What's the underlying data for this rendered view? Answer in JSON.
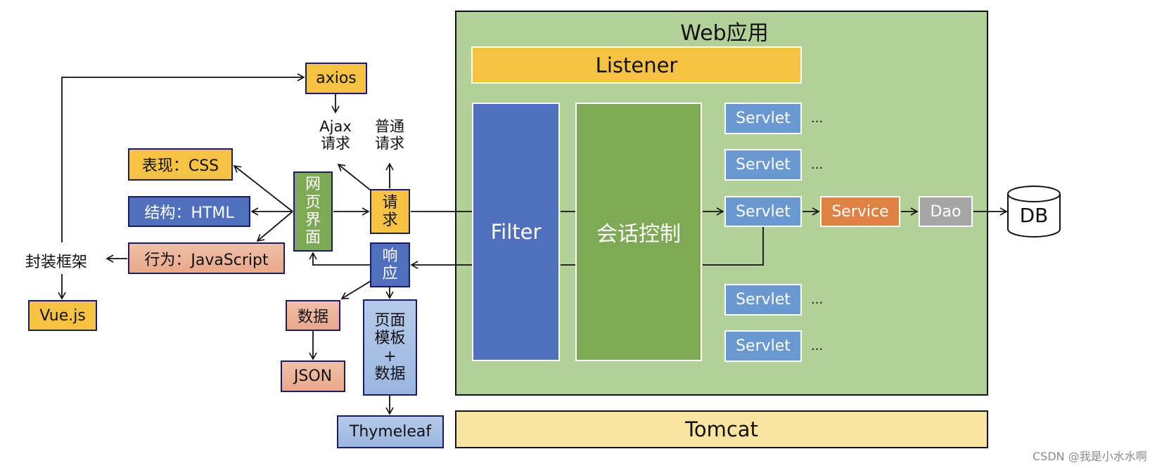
{
  "webapp": {
    "title": "Web应用",
    "listener": "Listener",
    "filter": "Filter",
    "session": "会话控制",
    "servlets": [
      {
        "label": "Servlet",
        "ellipsis": "..."
      },
      {
        "label": "Servlet",
        "ellipsis": "..."
      },
      {
        "label": "Servlet"
      },
      {
        "label": "Servlet",
        "ellipsis": "..."
      },
      {
        "label": "Servlet",
        "ellipsis": "..."
      }
    ],
    "service": "Service",
    "dao": "Dao"
  },
  "db": "DB",
  "tomcat": "Tomcat",
  "client": {
    "axios": "axios",
    "ajax_request": [
      "Ajax",
      "请求"
    ],
    "normal_request": [
      "普通",
      "请求"
    ],
    "css": "表现：CSS",
    "html": "结构：HTML",
    "js": "行为：JavaScript",
    "framework": "封装框架",
    "vue": "Vue.js",
    "webpage": [
      "网",
      "页",
      "界",
      "面"
    ],
    "request": [
      "请",
      "求"
    ],
    "response": [
      "响",
      "应"
    ],
    "data": "数据",
    "json": "JSON",
    "template": [
      "页面",
      "模板",
      "+",
      "数据"
    ],
    "thymeleaf": "Thymeleaf"
  },
  "watermark": "CSDN @我是小水水啊",
  "colors": {
    "webapp_bg": "#b2d198",
    "listener": "#f5c242",
    "filter": "#5070bd",
    "session": "#7ea955",
    "servlet": "#6a98d0",
    "service": "#e08243",
    "dao": "#a5a5a5",
    "tomcat": "#fae5a0"
  }
}
